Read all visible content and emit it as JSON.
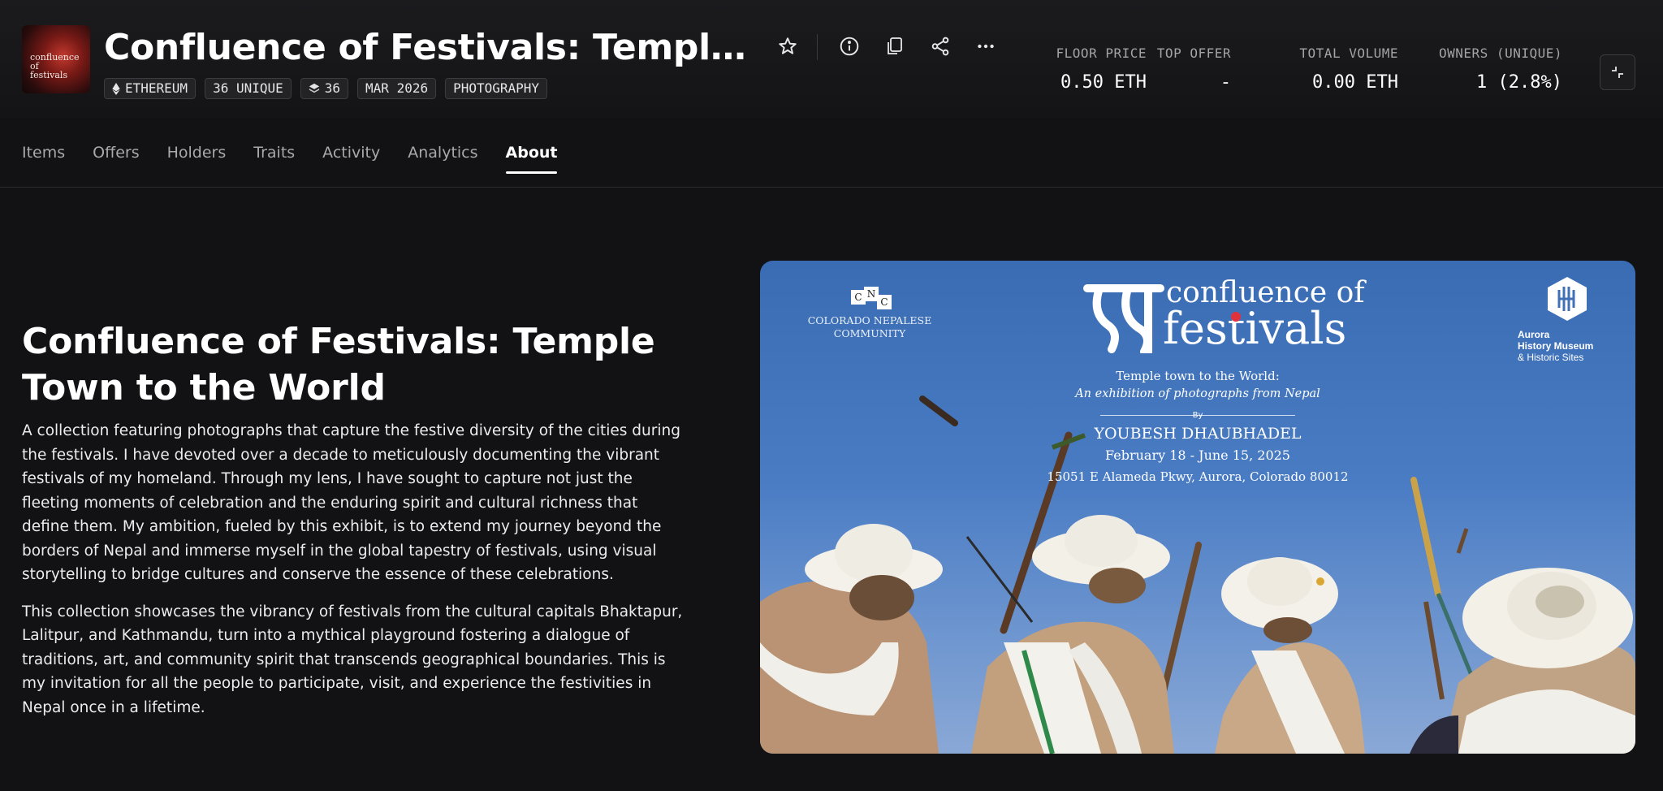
{
  "collection": {
    "title": "Confluence of Festivals: Temple Town to the World",
    "thumbnail_text": "confluence of festivals"
  },
  "tags": [
    {
      "icon": "ethereum-icon",
      "label": "ETHEREUM"
    },
    {
      "icon": "",
      "label": "36 UNIQUE"
    },
    {
      "icon": "layers-icon",
      "label": "36"
    },
    {
      "icon": "",
      "label": "MAR 2026"
    },
    {
      "icon": "",
      "label": "PHOTOGRAPHY"
    }
  ],
  "stats": [
    {
      "label": "FLOOR PRICE",
      "value": "0.50 ETH"
    },
    {
      "label": "TOP OFFER",
      "value": "-"
    },
    {
      "label": "TOTAL VOLUME",
      "value": "0.00 ETH"
    },
    {
      "label": "OWNERS (UNIQUE)",
      "value": "1 (2.8%)"
    }
  ],
  "tabs": [
    {
      "label": "Items",
      "active": false
    },
    {
      "label": "Offers",
      "active": false
    },
    {
      "label": "Holders",
      "active": false
    },
    {
      "label": "Traits",
      "active": false
    },
    {
      "label": "Activity",
      "active": false
    },
    {
      "label": "Analytics",
      "active": false
    },
    {
      "label": "About",
      "active": true
    }
  ],
  "about": {
    "heading": "Confluence of Festivals: Temple Town to the World",
    "paragraphs": [
      "A collection featuring photographs that capture the festive diversity of the cities during the festivals. I have devoted over a decade to meticulously documenting the vibrant festivals of my homeland. Through my lens, I have sought to capture not just the fleeting moments of celebration and the enduring spirit and cultural richness that define them. My ambition, fueled by this exhibit, is to extend my journey beyond the borders of Nepal and immerse myself in the global tapestry of festivals, using visual storytelling to bridge cultures and conserve the essence of these celebrations.",
      "This collection showcases the vibrancy of festivals from the cultural capitals Bhaktapur, Lalitpur, and Kathmandu, turn into a mythical playground fostering a dialogue of traditions, art, and community spirit that transcends geographical boundaries. This is my invitation for all the people to participate, visit, and experience the festivities in Nepal once in a lifetime."
    ]
  },
  "poster": {
    "cnc_letters": [
      "C",
      "N",
      "C"
    ],
    "cnc_name_line1": "COLORADO NEPALESE",
    "cnc_name_line2": "COMMUNITY",
    "title_line1": "confluence of",
    "title_line2": "festivals",
    "subtitle": "Temple town to the World:",
    "subtitle_italic": "An exhibition of photographs from Nepal",
    "by": "By",
    "photographer": "YOUBESH DHAUBHADEL",
    "dates": "February 18 - June 15, 2025",
    "address": "15051 E Alameda Pkwy, Aurora, Colorado 80012",
    "museum_line1": "Aurora",
    "museum_line2": "History Museum",
    "museum_line3": "& Historic Sites"
  },
  "colors": {
    "background": "#121214",
    "text_muted": "#a9a9ad",
    "poster_sky": "#3a6cb4"
  }
}
